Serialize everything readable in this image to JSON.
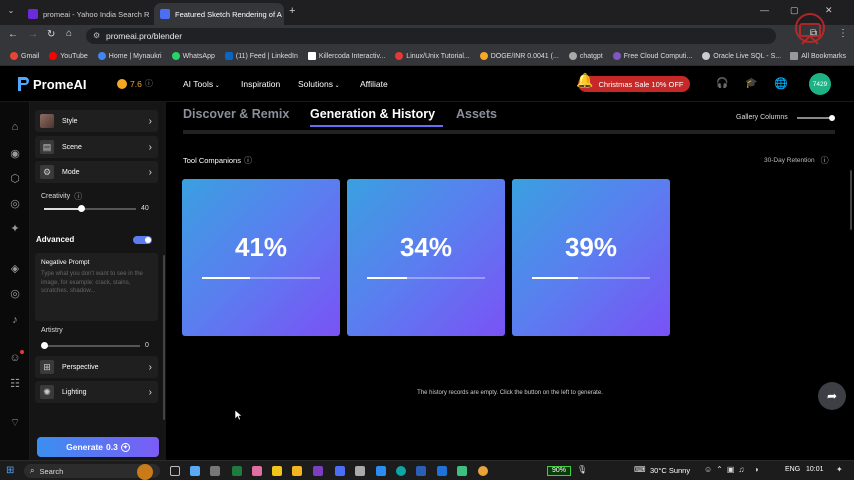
{
  "browser": {
    "tabs": [
      {
        "label": "promeai - Yahoo India Search R",
        "favicon_color": "#6c2bd9",
        "active": false
      },
      {
        "label": "Featured Sketch Rendering of A",
        "favicon_color": "#4b6ef5",
        "active": true
      }
    ],
    "url": "promeai.pro/blender",
    "bookmarks": [
      {
        "label": "Gmail",
        "color": "#ea4335"
      },
      {
        "label": "YouTube",
        "color": "#ff0000"
      },
      {
        "label": "Home | Mynaukri",
        "color": "#4285f4"
      },
      {
        "label": "WhatsApp",
        "color": "#25d366"
      },
      {
        "label": "(11) Feed | LinkedIn",
        "color": "#0a66c2"
      },
      {
        "label": "Killercoda Interactiv...",
        "color": "#ffffff"
      },
      {
        "label": "Linux/Unix Tutorial...",
        "color": "#e53935"
      },
      {
        "label": "DOGE/INR 0.0041 (...",
        "color": "#f9a825"
      },
      {
        "label": "chatgpt",
        "color": "#aaaaaa"
      },
      {
        "label": "Free Cloud Computi...",
        "color": "#7e57c2"
      },
      {
        "label": "Oracle Live SQL - S...",
        "color": "#cccccc"
      }
    ],
    "all_bookmarks": "All Bookmarks"
  },
  "header": {
    "logo_text": "PromeAI",
    "credits": "7.6",
    "nav": [
      "AI Tools",
      "Inspiration",
      "Solutions",
      "Affiliate"
    ],
    "promo": "Christmas Sale 10% OFF",
    "avatar": "7429",
    "accent": "#1db385"
  },
  "sidebar": {
    "rows_top": [
      {
        "label": "Style",
        "icon": "style-icon"
      },
      {
        "label": "Scene",
        "icon": "scene-icon"
      },
      {
        "label": "Mode",
        "icon": "mode-icon"
      }
    ],
    "creativity_label": "Creativity",
    "creativity_value": "40",
    "creativity_fraction": 0.4,
    "advanced_label": "Advanced",
    "negative_prompt_label": "Negative Prompt",
    "negative_prompt_placeholder": "Type what you don't want to see in the image, for example: crack, stains, scratches, shadow...",
    "artistry_label": "Artistry",
    "artistry_value": "0",
    "rows_bottom": [
      {
        "label": "Perspective",
        "icon": "perspective-icon"
      },
      {
        "label": "Lighting",
        "icon": "lighting-icon"
      }
    ],
    "generate_label": "Generate",
    "generate_cost": "0.3"
  },
  "main": {
    "tabs": [
      "Discover & Remix",
      "Generation & History",
      "Assets"
    ],
    "gallery_columns_label": "Gallery Columns",
    "tool_companions_label": "Tool Companions",
    "retention_label": "30-Day Retention",
    "cards": [
      {
        "percent": "41%",
        "progress": 0.41
      },
      {
        "percent": "34%",
        "progress": 0.34
      },
      {
        "percent": "39%",
        "progress": 0.39
      }
    ],
    "empty_message": "The history records are empty. Click the button on the left to generate."
  },
  "taskbar": {
    "search": "Search",
    "battery": "90%",
    "weather": "30°C  Sunny",
    "lang": "ENG",
    "time": "10:01"
  }
}
